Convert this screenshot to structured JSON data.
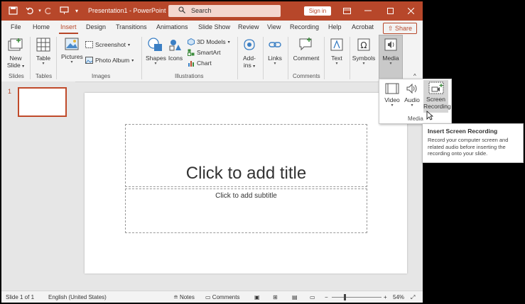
{
  "titlebar": {
    "doc_title": "Presentation1 - PowerPoint",
    "search_placeholder": "Search",
    "sign_in": "Sign in"
  },
  "tabs": [
    "File",
    "Home",
    "Insert",
    "Design",
    "Transitions",
    "Animations",
    "Slide Show",
    "Review",
    "View",
    "Recording",
    "Help",
    "Acrobat"
  ],
  "active_tab": "Insert",
  "share_label": "Share",
  "ribbon": {
    "new_slide": "New",
    "new_slide_2": "Slide",
    "table": "Table",
    "pictures": "Pictures",
    "screenshot": "Screenshot",
    "photo_album": "Photo Album",
    "shapes": "Shapes",
    "icons": "Icons",
    "models_3d": "3D Models",
    "smartart": "SmartArt",
    "chart": "Chart",
    "addins": "Add-",
    "addins_2": "ins",
    "links": "Links",
    "comment": "Comment",
    "text": "Text",
    "symbols": "Symbols",
    "media": "Media",
    "groups": {
      "slides": "Slides",
      "tables": "Tables",
      "images": "Images",
      "illustrations": "Illustrations",
      "comments": "Comments"
    }
  },
  "thumbnail_number": "1",
  "slide": {
    "title_placeholder": "Click to add title",
    "subtitle_placeholder": "Click to add subtitle"
  },
  "media_dropdown": {
    "video": "Video",
    "audio": "Audio",
    "screen_recording_1": "Screen",
    "screen_recording_2": "Recording",
    "group_label": "Media"
  },
  "tooltip": {
    "title": "Insert Screen Recording",
    "body": "Record your computer screen and related audio before inserting the recording onto your slide."
  },
  "statusbar": {
    "slide_info": "Slide 1 of 1",
    "language": "English (United States)",
    "notes": "Notes",
    "comments": "Comments",
    "zoom": "54%"
  },
  "colors": {
    "accent": "#b7472a",
    "ribbon_bg": "#f3f3f3",
    "workspace": "#e6e6e6"
  }
}
